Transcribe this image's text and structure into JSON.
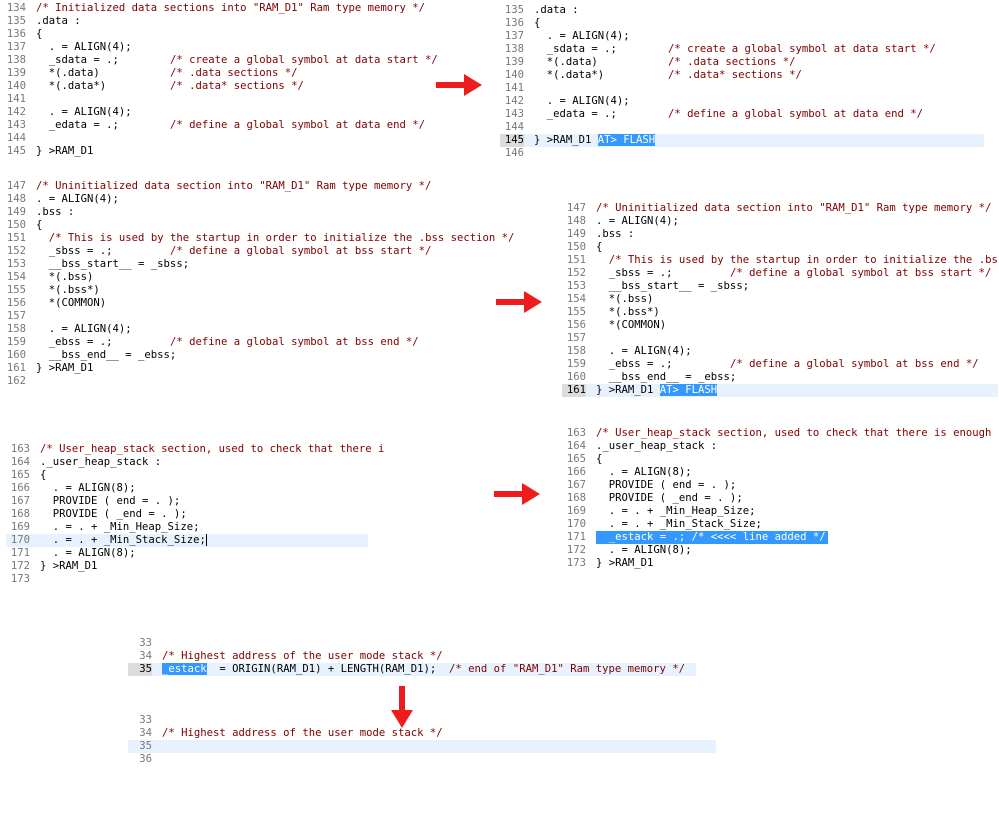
{
  "colors": {
    "comment": "#7f0000",
    "selection": "#3399ff",
    "current_line": "#e8f2fe",
    "arrow": "#ee1c1c"
  },
  "p1": [
    {
      "ln": "134",
      "t": "/* Initialized data sections into \"RAM_D1\" Ram type memory */"
    },
    {
      "ln": "135",
      "t": ".data :"
    },
    {
      "ln": "136",
      "t": "{"
    },
    {
      "ln": "137",
      "t": "  . = ALIGN(4);"
    },
    {
      "ln": "138",
      "t": "  _sdata = .;        /* create a global symbol at data start */"
    },
    {
      "ln": "139",
      "t": "  *(.data)           /* .data sections */"
    },
    {
      "ln": "140",
      "t": "  *(.data*)          /* .data* sections */"
    },
    {
      "ln": "141",
      "t": ""
    },
    {
      "ln": "142",
      "t": "  . = ALIGN(4);"
    },
    {
      "ln": "143",
      "t": "  _edata = .;        /* define a global symbol at data end */"
    },
    {
      "ln": "144",
      "t": ""
    },
    {
      "ln": "145",
      "t": "} >RAM_D1"
    }
  ],
  "p2": [
    {
      "ln": "135",
      "t": ".data :"
    },
    {
      "ln": "136",
      "t": "{"
    },
    {
      "ln": "137",
      "t": "  . = ALIGN(4);"
    },
    {
      "ln": "138",
      "t": "  _sdata = .;        /* create a global symbol at data start */"
    },
    {
      "ln": "139",
      "t": "  *(.data)           /* .data sections */"
    },
    {
      "ln": "140",
      "t": "  *(.data*)          /* .data* sections */"
    },
    {
      "ln": "141",
      "t": ""
    },
    {
      "ln": "142",
      "t": "  . = ALIGN(4);"
    },
    {
      "ln": "143",
      "t": "  _edata = .;        /* define a global symbol at data end */"
    },
    {
      "ln": "144",
      "t": ""
    },
    {
      "ln": "145",
      "t": "} >RAM_D1 ",
      "sel": "AT> FLASH",
      "cur": true
    },
    {
      "ln": "146",
      "t": ""
    }
  ],
  "p3": [
    {
      "ln": "147",
      "t": "/* Uninitialized data section into \"RAM_D1\" Ram type memory */"
    },
    {
      "ln": "148",
      "t": ". = ALIGN(4);"
    },
    {
      "ln": "149",
      "t": ".bss :"
    },
    {
      "ln": "150",
      "t": "{"
    },
    {
      "ln": "151",
      "t": "  /* This is used by the startup in order to initialize the .bss section */"
    },
    {
      "ln": "152",
      "t": "  _sbss = .;         /* define a global symbol at bss start */"
    },
    {
      "ln": "153",
      "t": "  __bss_start__ = _sbss;"
    },
    {
      "ln": "154",
      "t": "  *(.bss)"
    },
    {
      "ln": "155",
      "t": "  *(.bss*)"
    },
    {
      "ln": "156",
      "t": "  *(COMMON)"
    },
    {
      "ln": "157",
      "t": ""
    },
    {
      "ln": "158",
      "t": "  . = ALIGN(4);"
    },
    {
      "ln": "159",
      "t": "  _ebss = .;         /* define a global symbol at bss end */"
    },
    {
      "ln": "160",
      "t": "  __bss_end__ = _ebss;"
    },
    {
      "ln": "161",
      "t": "} >RAM_D1"
    },
    {
      "ln": "162",
      "t": ""
    }
  ],
  "p4": [
    {
      "ln": "147",
      "t": "/* Uninitialized data section into \"RAM_D1\" Ram type memory */"
    },
    {
      "ln": "148",
      "t": ". = ALIGN(4);"
    },
    {
      "ln": "149",
      "t": ".bss :"
    },
    {
      "ln": "150",
      "t": "{"
    },
    {
      "ln": "151",
      "t": "  /* This is used by the startup in order to initialize the .bss s"
    },
    {
      "ln": "152",
      "t": "  _sbss = .;         /* define a global symbol at bss start */"
    },
    {
      "ln": "153",
      "t": "  __bss_start__ = _sbss;"
    },
    {
      "ln": "154",
      "t": "  *(.bss)"
    },
    {
      "ln": "155",
      "t": "  *(.bss*)"
    },
    {
      "ln": "156",
      "t": "  *(COMMON)"
    },
    {
      "ln": "157",
      "t": ""
    },
    {
      "ln": "158",
      "t": "  . = ALIGN(4);"
    },
    {
      "ln": "159",
      "t": "  _ebss = .;         /* define a global symbol at bss end */"
    },
    {
      "ln": "160",
      "t": "  __bss_end__ = _ebss;"
    },
    {
      "ln": "161",
      "t": "} >RAM_D1 ",
      "sel": "AT> FLASH",
      "cur": true
    }
  ],
  "p5": [
    {
      "ln": "163",
      "t": "/* User_heap_stack section, used to check that there i"
    },
    {
      "ln": "164",
      "t": "._user_heap_stack :"
    },
    {
      "ln": "165",
      "t": "{"
    },
    {
      "ln": "166",
      "t": "  . = ALIGN(8);"
    },
    {
      "ln": "167",
      "t": "  PROVIDE ( end = . );"
    },
    {
      "ln": "168",
      "t": "  PROVIDE ( _end = . );"
    },
    {
      "ln": "169",
      "t": "  . = . + _Min_Heap_Size;"
    },
    {
      "ln": "170",
      "t": "  . = . + _Min_Stack_Size;",
      "caret": true,
      "cur": true
    },
    {
      "ln": "171",
      "t": "  . = ALIGN(8);"
    },
    {
      "ln": "172",
      "t": "} >RAM_D1"
    },
    {
      "ln": "173",
      "t": ""
    }
  ],
  "p6": [
    {
      "ln": "163",
      "t": "/* User_heap_stack section, used to check that there is enough \"RA"
    },
    {
      "ln": "164",
      "t": "._user_heap_stack :"
    },
    {
      "ln": "165",
      "t": "{"
    },
    {
      "ln": "166",
      "t": "  . = ALIGN(8);"
    },
    {
      "ln": "167",
      "t": "  PROVIDE ( end = . );"
    },
    {
      "ln": "168",
      "t": "  PROVIDE ( _end = . );"
    },
    {
      "ln": "169",
      "t": "  . = . + _Min_Heap_Size;"
    },
    {
      "ln": "170",
      "t": "  . = . + _Min_Stack_Size;"
    },
    {
      "ln": "171",
      "t": "",
      "sel": "  _estack = .; /* <<<< line added */",
      "fullsel": true
    },
    {
      "ln": "172",
      "t": "  . = ALIGN(8);"
    },
    {
      "ln": "173",
      "t": "} >RAM_D1"
    }
  ],
  "p7": [
    {
      "ln": "33",
      "t": ""
    },
    {
      "ln": "34",
      "t": "/* Highest address of the user mode stack */"
    },
    {
      "ln": "35",
      "t": "  = ORIGIN(RAM_D1) + LENGTH(RAM_D1);  /* end of \"RAM_D1\" Ram type memory */",
      "sel": "_estack",
      "selfirst": true,
      "cur": true
    }
  ],
  "p8": [
    {
      "ln": "33",
      "t": ""
    },
    {
      "ln": "34",
      "t": "/* Highest address of the user mode stack */"
    },
    {
      "ln": "35",
      "t": "",
      "cur": true
    },
    {
      "ln": "36",
      "t": ""
    }
  ]
}
